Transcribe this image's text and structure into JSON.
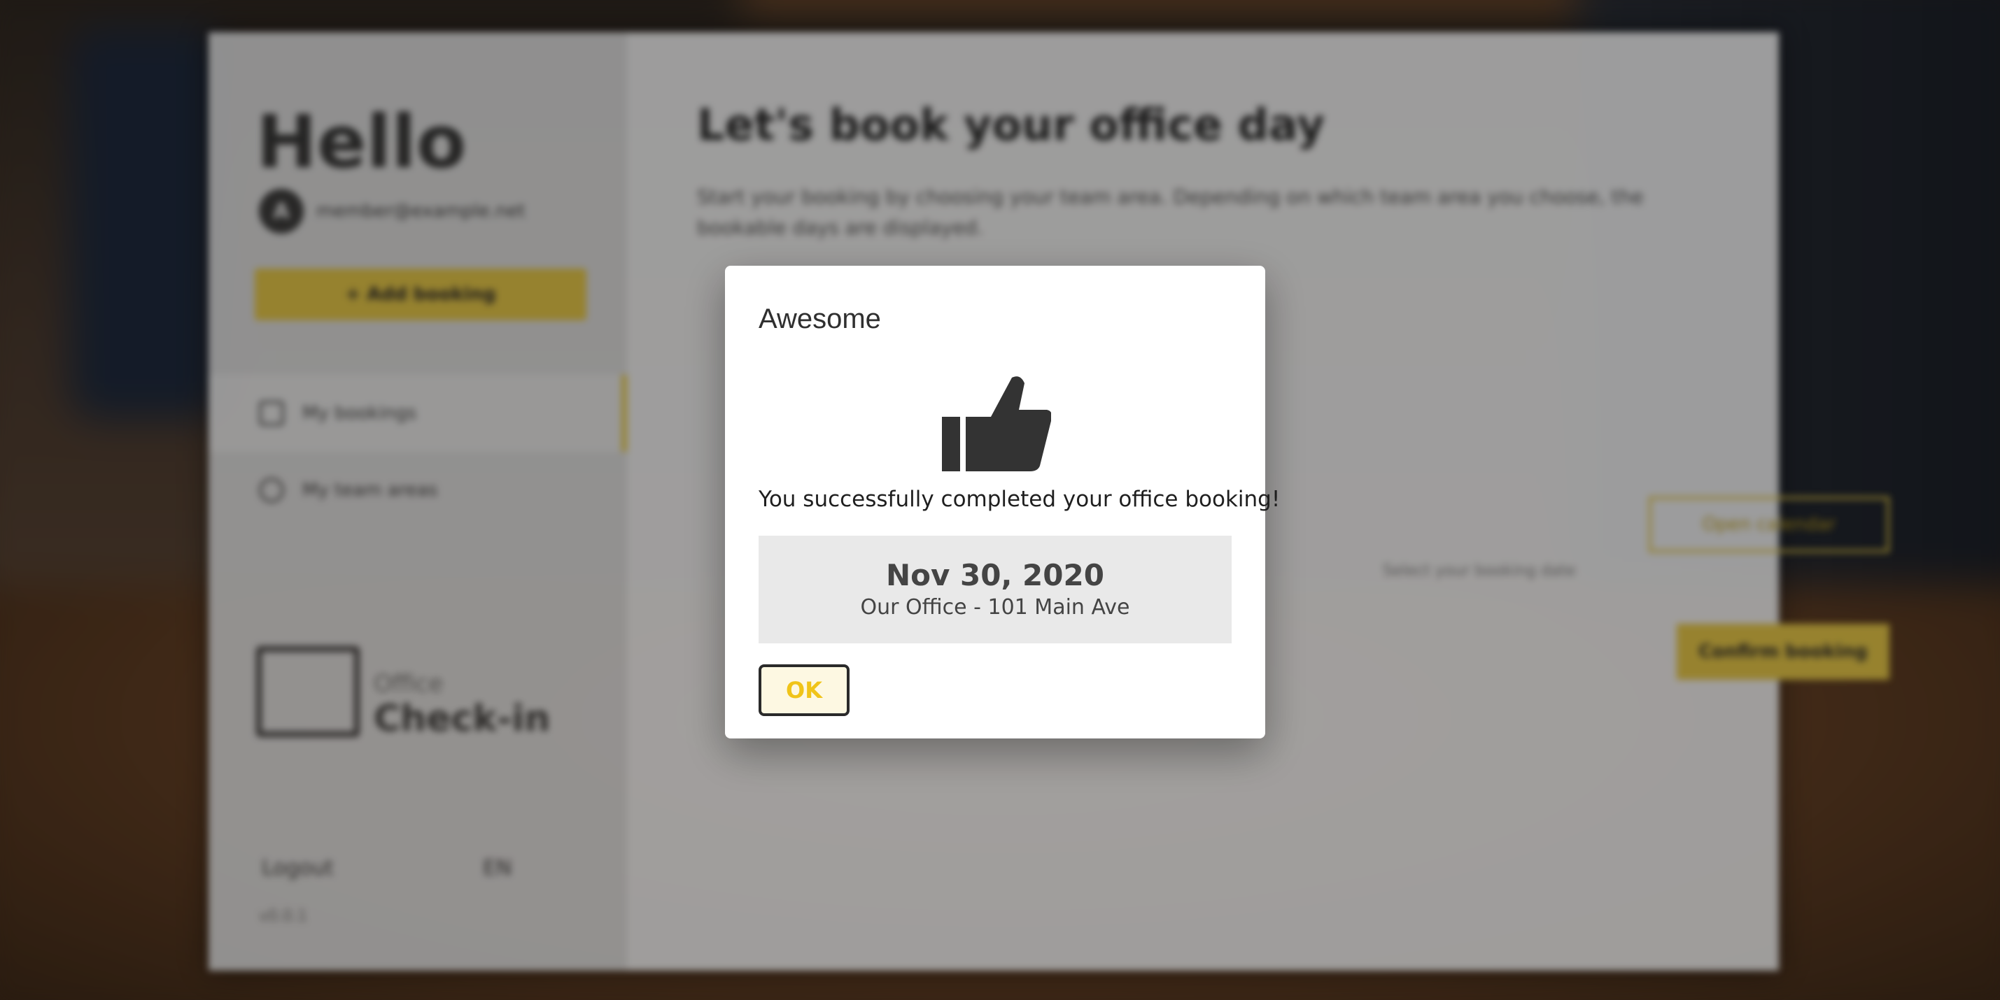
{
  "app": {
    "greeting": "Hello",
    "user_email": "member@example.net",
    "avatar_initial": "A",
    "add_booking_label": "+ Add booking",
    "nav": [
      {
        "label": "My bookings"
      },
      {
        "label": "My team areas"
      }
    ],
    "logo_small": "Office",
    "logo_big": "Check-in",
    "logout_label": "Logout",
    "language_label": "EN",
    "version": "v0.0.1",
    "main_title": "Let's book your office day",
    "main_description": "Start your booking by choosing your team area. Depending on which team area you choose, the bookable days are displayed.",
    "open_calendar_label": "Open calendar",
    "hint_text": "Select your booking date",
    "confirm_label": "Confirm booking"
  },
  "modal": {
    "title": "Awesome",
    "message": "You successfully completed your office booking!",
    "booking_date": "Nov 30, 2020",
    "booking_location": "Our Office - 101 Main Ave",
    "ok_label": "OK",
    "icon": "thumbs-up-icon"
  },
  "colors": {
    "accent": "#f2d34c",
    "ok_text": "#f0c419",
    "dark": "#3b3b3b"
  }
}
